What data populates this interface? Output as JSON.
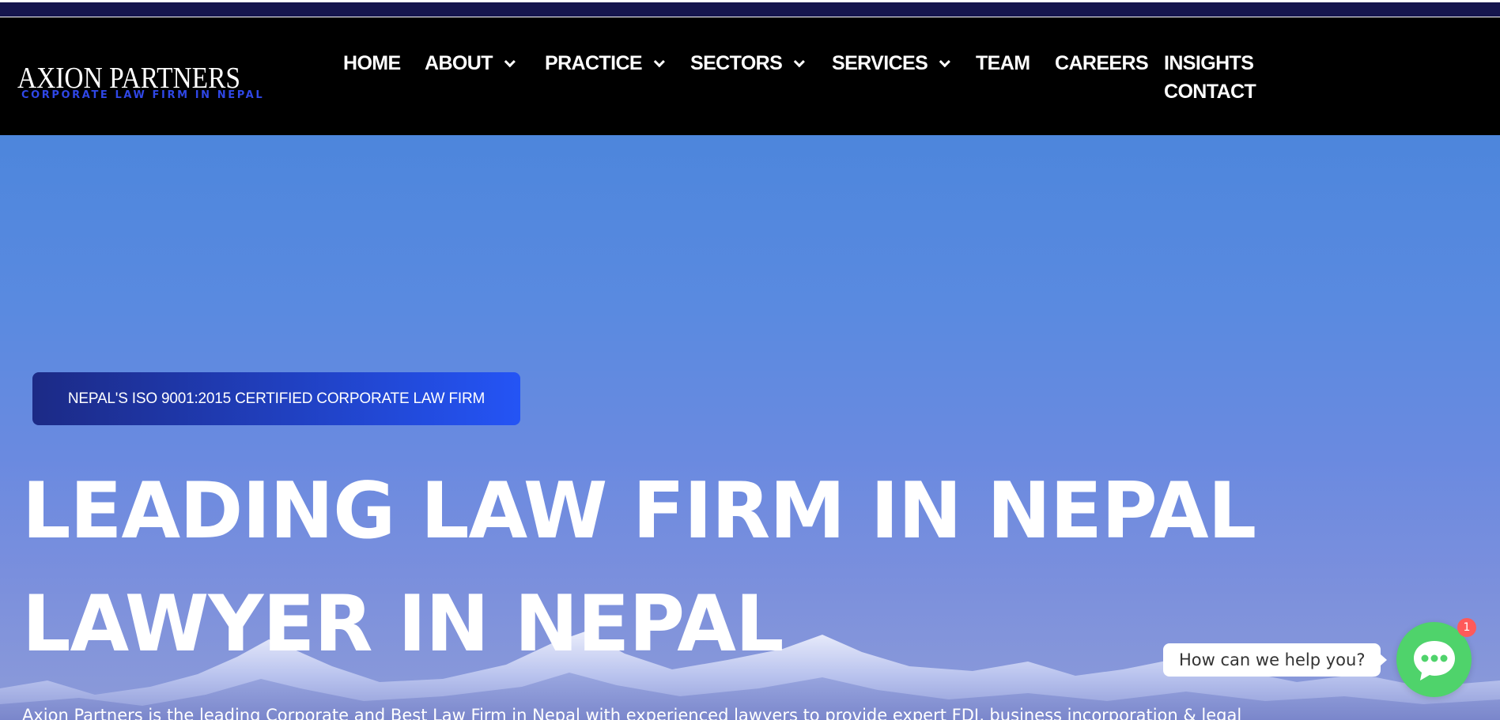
{
  "logo": {
    "name": "AXION PARTNERS",
    "tagline": "CORPORATE LAW FIRM IN NEPAL"
  },
  "nav": {
    "items": [
      {
        "label": "HOME",
        "has_dropdown": false
      },
      {
        "label": "ABOUT",
        "has_dropdown": true
      },
      {
        "label": "PRACTICE",
        "has_dropdown": true
      },
      {
        "label": "SECTORS",
        "has_dropdown": true
      },
      {
        "label": "SERVICES",
        "has_dropdown": true
      },
      {
        "label": "TEAM",
        "has_dropdown": false
      },
      {
        "label": "CAREERS",
        "has_dropdown": false
      },
      {
        "label": "INSIGHTS",
        "has_dropdown": false
      },
      {
        "label": "CONTACT",
        "has_dropdown": false
      }
    ]
  },
  "hero": {
    "badge": "NEPAL'S ISO 9001:2015 CERTIFIED CORPORATE LAW FIRM",
    "headline_line1": "LEADING LAW FIRM IN NEPAL",
    "headline_line2": "LAWYER IN NEPAL",
    "paragraph": "Axion Partners is the leading Corporate and Best Law Firm in Nepal with experienced lawyers to provide expert FDI, business incorporation & legal"
  },
  "chat": {
    "prompt": "How can we help you?",
    "unread_count": "1"
  },
  "colors": {
    "top_strip": "#16164e",
    "header_bg": "#000000",
    "logo_tagline": "#2f47e6",
    "badge_start": "#1c2a86",
    "badge_end": "#2454f5",
    "chat_button": "#4fd36b",
    "chat_badge": "#ff5a5a"
  },
  "icons": {
    "dropdown": "chevron-down-icon",
    "chat": "chat-bubble-dots-icon"
  }
}
